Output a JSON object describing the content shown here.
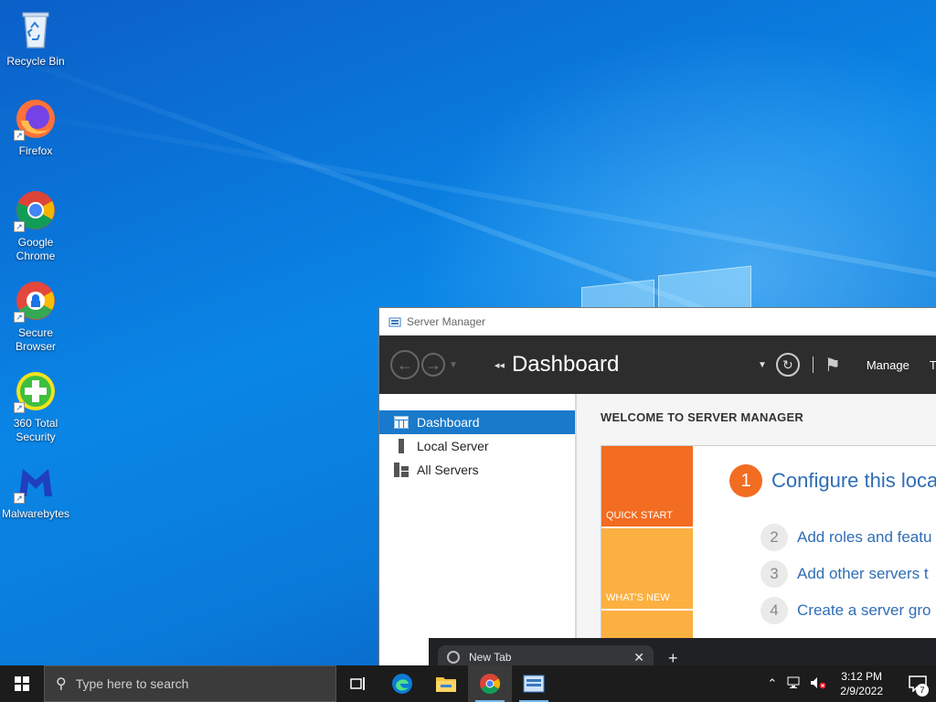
{
  "desktop": {
    "icons": [
      {
        "label": "Recycle Bin",
        "icon": "recycle-bin-icon"
      },
      {
        "label": "Firefox",
        "icon": "firefox-icon"
      },
      {
        "label": "Google Chrome",
        "icon": "chrome-icon"
      },
      {
        "label": "Secure Browser",
        "icon": "secure-browser-icon"
      },
      {
        "label": "360 Total Security",
        "icon": "360-security-icon"
      },
      {
        "label": "Malwarebytes",
        "icon": "malwarebytes-icon"
      }
    ]
  },
  "server_manager": {
    "window_title": "Server Manager",
    "breadcrumb": "Dashboard",
    "menu": {
      "manage": "Manage",
      "tools_partial": "T"
    },
    "sidebar": [
      {
        "label": "Dashboard",
        "icon": "dashboard-icon",
        "active": true
      },
      {
        "label": "Local Server",
        "icon": "server-icon",
        "active": false
      },
      {
        "label": "All Servers",
        "icon": "servers-icon",
        "active": false
      }
    ],
    "welcome": "WELCOME TO SERVER MANAGER",
    "tiles": {
      "quick_start": "QUICK START",
      "whats_new": "WHAT'S NEW"
    },
    "steps": [
      {
        "num": "1",
        "text": "Configure this loca"
      },
      {
        "num": "2",
        "text": "Add roles and featu"
      },
      {
        "num": "3",
        "text": "Add other servers t"
      },
      {
        "num": "4",
        "text": "Create a server gro"
      }
    ]
  },
  "chrome": {
    "tab_title": "New Tab",
    "close": "✕",
    "new_tab": "+"
  },
  "taskbar": {
    "search_placeholder": "Type here to search",
    "time": "3:12 PM",
    "date": "2/9/2022",
    "notification_count": "7"
  },
  "colors": {
    "accent": "#1979ca",
    "quick_start": "#f26c21",
    "whats_new": "#fbb041"
  }
}
